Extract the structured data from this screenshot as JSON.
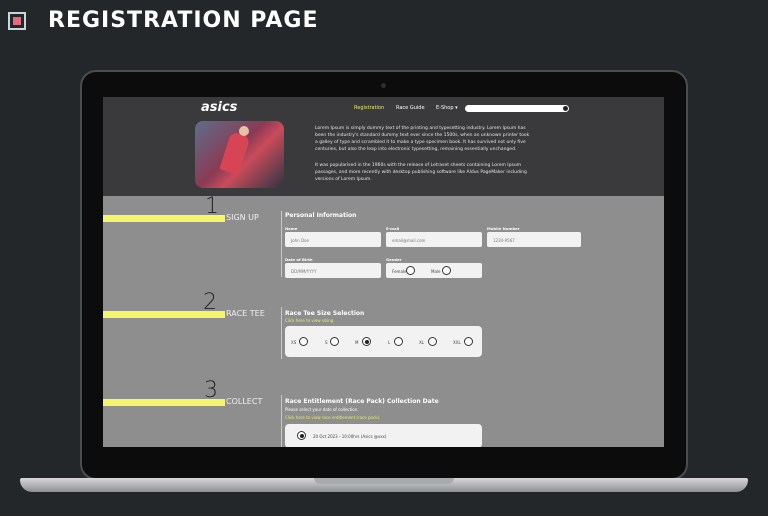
{
  "slide": {
    "title": "REGISTRATION PAGE"
  },
  "site": {
    "logo": "asics",
    "nav": [
      {
        "label": "Registration",
        "active": true
      },
      {
        "label": "Race Guide",
        "active": false
      },
      {
        "label": "E-Shop ▾",
        "active": false
      }
    ],
    "hero_paragraphs": [
      "Lorem Ipsum is simply dummy text of the printing and typesetting industry. Lorem Ipsum has been the industry's standard dummy text ever since the 1500s, when an unknown printer took a galley of type and scrambled it to make a type specimen book. It has survived not only five centuries, but also the leap into electronic typesetting, remaining essentially unchanged.",
      "It was popularised in the 1960s with the release of Letraset sheets containing Lorem Ipsum passages, and more recently with desktop publishing software like Aldus PageMaker including versions of Lorem Ipsum."
    ]
  },
  "steps": {
    "signup": {
      "number": "1",
      "label": "SIGN UP",
      "title": "Personal Information",
      "fields": {
        "name_label": "Name",
        "name_value": "John Doe",
        "email_label": "E-mail",
        "email_value": "email@mail.com",
        "mobile_label": "Mobile Number",
        "mobile_value": "1234-9567",
        "dob_label": "Date of Birth",
        "dob_value": "DD/MM/YYYY",
        "gender_label": "Gender",
        "female": "Female",
        "male": "Male"
      }
    },
    "race_tee": {
      "number": "2",
      "label": "RACE TEE",
      "title": "Race Tee Size Selection",
      "link": "Click here to view sizing.",
      "sizes": [
        "XS",
        "S",
        "M",
        "L",
        "XL",
        "XXL"
      ],
      "selected": "M"
    },
    "collect": {
      "number": "3",
      "label": "COLLECT",
      "title": "Race Entitlement (Race Pack) Collection Date",
      "subtitle": "Please select your date of collection.",
      "link": "Click here to view race entitlement (race pack).",
      "option": "20 Oct 2023 - 10:00hrs (Asics @xxx)"
    }
  },
  "colors": {
    "accent": "#f5f56e",
    "screen_bg": "#8e8e8e",
    "nav_bg": "#3a3a3c"
  }
}
